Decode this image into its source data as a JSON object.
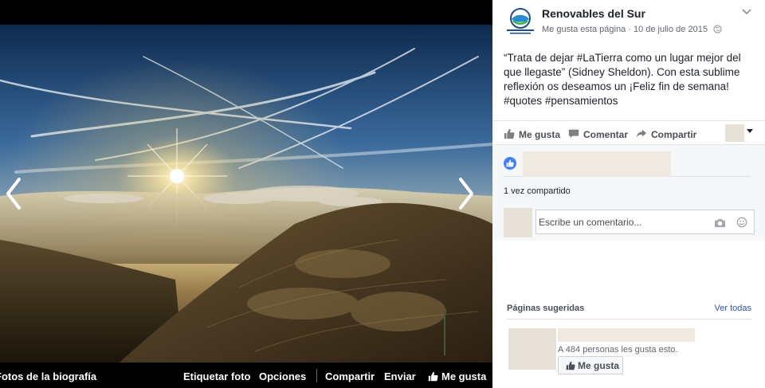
{
  "viewer": {
    "photo_alt": "Mountain landscape at sunset above the clouds",
    "bar": {
      "album": "Fotos de la biografía",
      "tag_photo": "Etiquetar foto",
      "options": "Opciones",
      "share": "Compartir",
      "send": "Enviar",
      "like": "Me gusta"
    },
    "icons": {
      "prev": "chevron-left-icon",
      "next": "chevron-right-icon"
    }
  },
  "post": {
    "page_name": "Renovables del Sur",
    "like_page": "Me gusta esta página",
    "separator": " · ",
    "date": "10 de julio de 2015",
    "visibility_icon": "globe-icon",
    "text": {
      "p1": "“Trata de dejar ",
      "tag1": "#LaTierra",
      "p2": " como un lugar mejor del que llegaste” (Sidney Sheldon). Con esta sublime reflexión os deseamos un ¡Feliz fin de semana!",
      "tag2": "#quotes",
      "tag3": "#pensamientos"
    },
    "actions": {
      "like": "Me gusta",
      "comment": "Comentar",
      "share": "Compartir"
    },
    "shares": "1 vez compartido",
    "comment_placeholder": "Escribe un comentario..."
  },
  "suggested": {
    "title": "Páginas sugeridas",
    "see_all": "Ver todas",
    "count": "A 484 personas les gusta esto.",
    "like_button": "Me gusta"
  },
  "colors": {
    "link": "#365899",
    "like_blue": "#4080ff",
    "text": "#1d2129",
    "secondary": "#616770"
  }
}
